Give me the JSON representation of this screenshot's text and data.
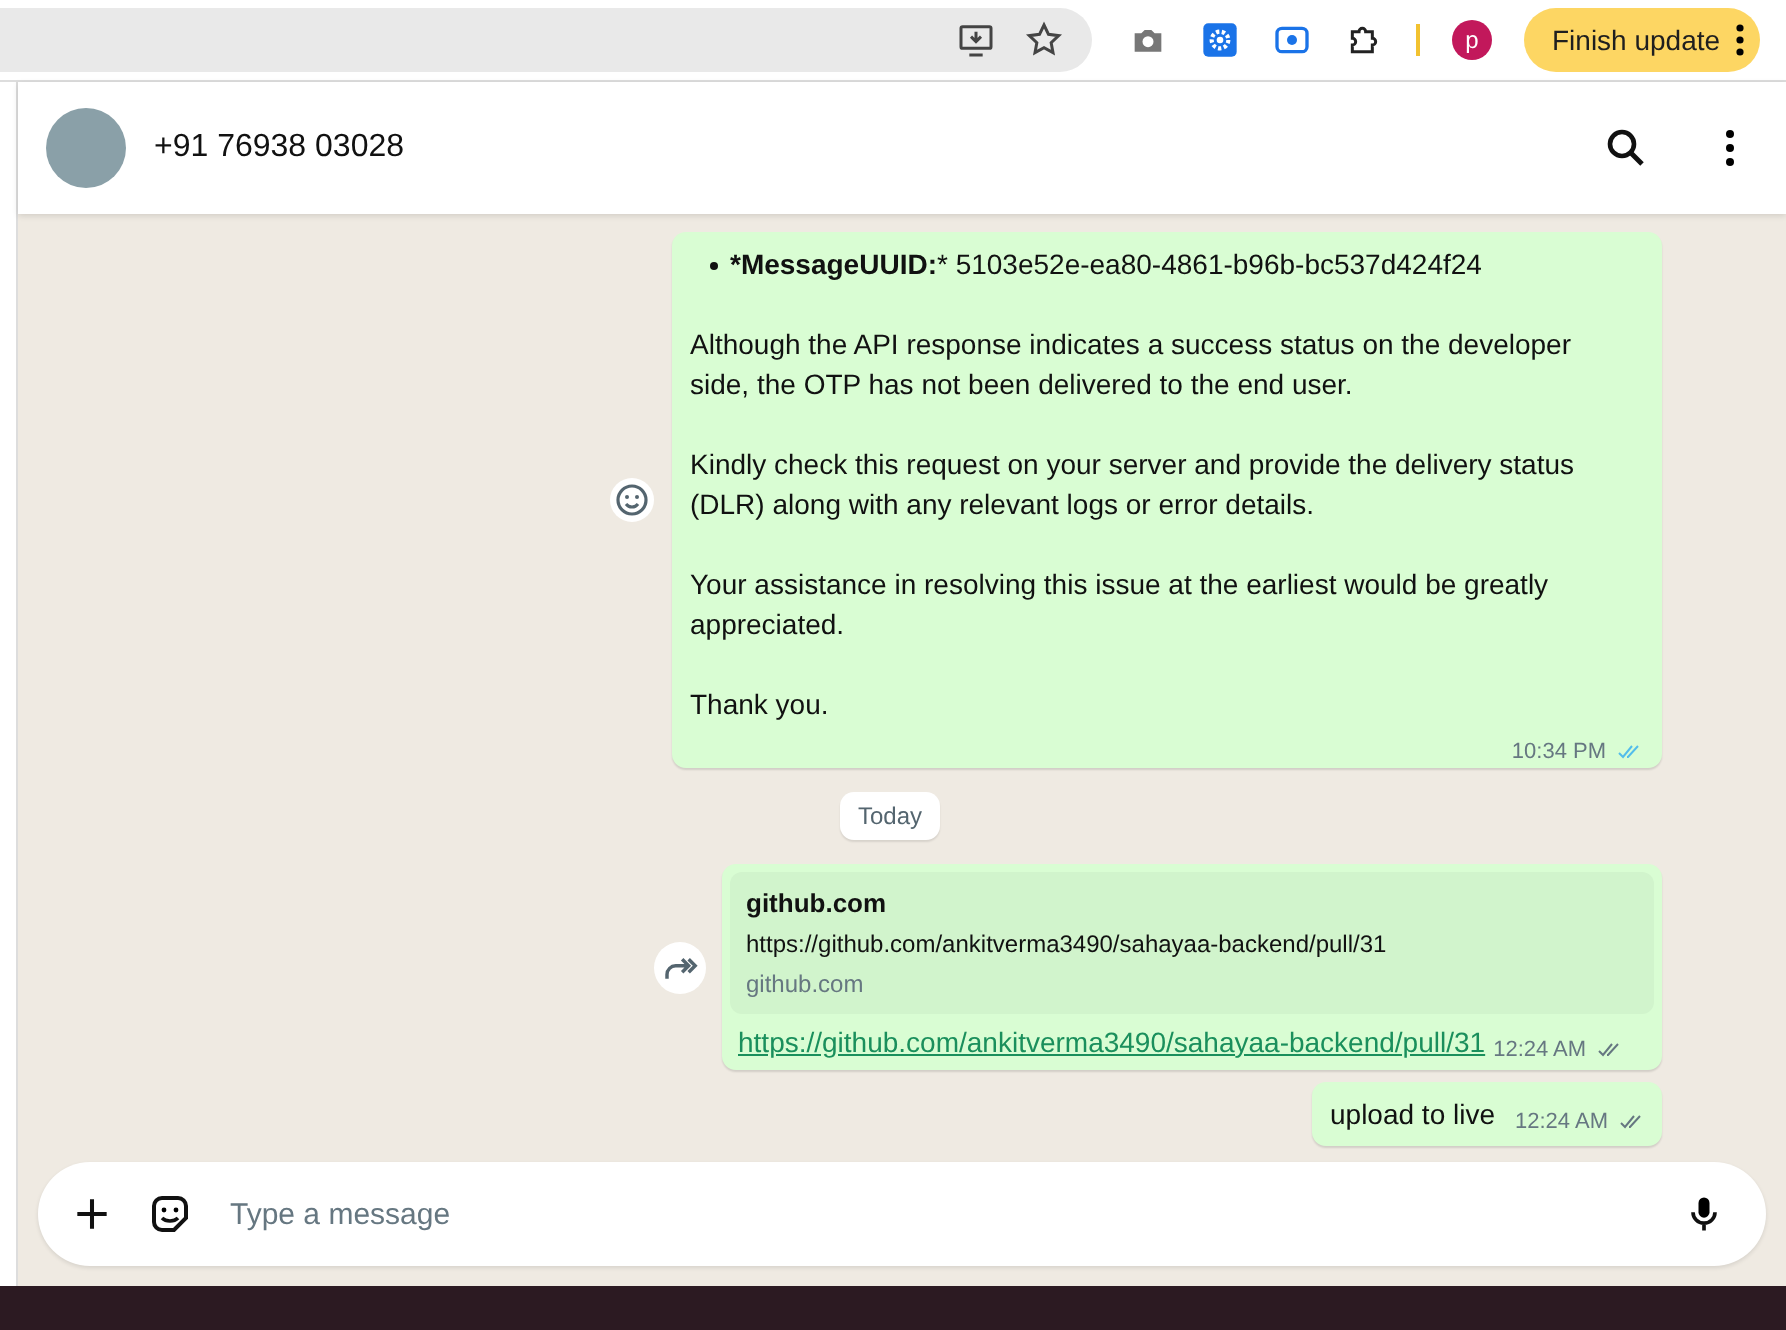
{
  "browser": {
    "profile_initial": "p",
    "update_button": "Finish update"
  },
  "chat_header": {
    "contact": "+91 76938 03028"
  },
  "messages": [
    {
      "kind": "text",
      "outgoing": true,
      "bullets": [
        {
          "label": "*MessageUUID:",
          "value": "* 5103e52e-ea80-4861-b96b-bc537d424f24"
        }
      ],
      "paragraphs": [
        "Although the API response indicates a success status on the developer side, the OTP has not been delivered to the end user.",
        "Kindly check this request on your server and provide the delivery status (DLR) along with any relevant logs or error details.",
        "Your assistance in resolving this issue at the earliest would be greatly appreciated.",
        "Thank you."
      ],
      "time": "10:34 PM",
      "read": true
    },
    {
      "kind": "date",
      "label": "Today"
    },
    {
      "kind": "link",
      "outgoing": true,
      "preview": {
        "title": "github.com",
        "description": "https://github.com/ankitverma3490/sahayaa-backend/pull/31",
        "domain": "github.com"
      },
      "link": "https://github.com/ankitverma3490/sahayaa-backend/pull/31",
      "time": "12:24 AM",
      "read": false
    },
    {
      "kind": "text",
      "outgoing": true,
      "paragraphs": [
        "upload to live"
      ],
      "time": "12:24 AM",
      "read": false
    }
  ],
  "composer": {
    "placeholder": "Type a message"
  }
}
